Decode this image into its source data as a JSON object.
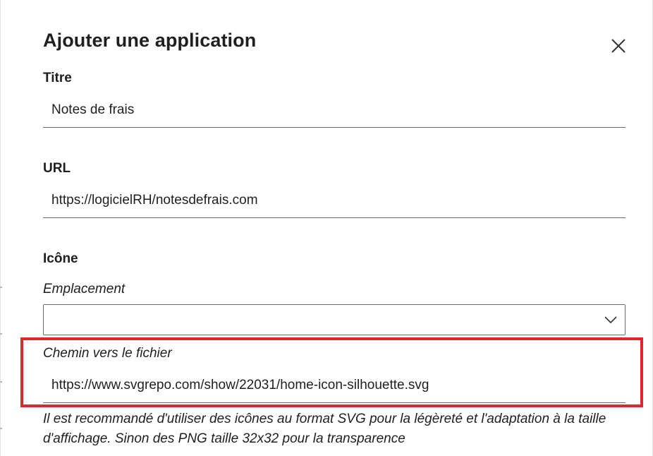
{
  "dialog": {
    "title": "Ajouter une application",
    "close_icon": "close-icon"
  },
  "fields": {
    "titre": {
      "label": "Titre",
      "value": "Notes de frais"
    },
    "url": {
      "label": "URL",
      "value": "https://logicielRH/notesdefrais.com"
    },
    "icone": {
      "label": "Icône",
      "emplacement_label": "Emplacement",
      "emplacement_value": "",
      "dropdown_icon": "chevron-down-icon",
      "chemin_label": "Chemin vers le fichier",
      "chemin_value": "https://www.svgrepo.com/show/22031/home-icon-silhouette.svg",
      "help_text": "Il est recommandé d'utiliser des icônes au format SVG pour la légèreté et l'adaptation à la taille d'affichage. Sinon des PNG taille 32x32 pour la transparence"
    }
  },
  "colors": {
    "highlight": "#e0262d",
    "text": "#1f1f1f",
    "underline": "#6b6b6b"
  }
}
